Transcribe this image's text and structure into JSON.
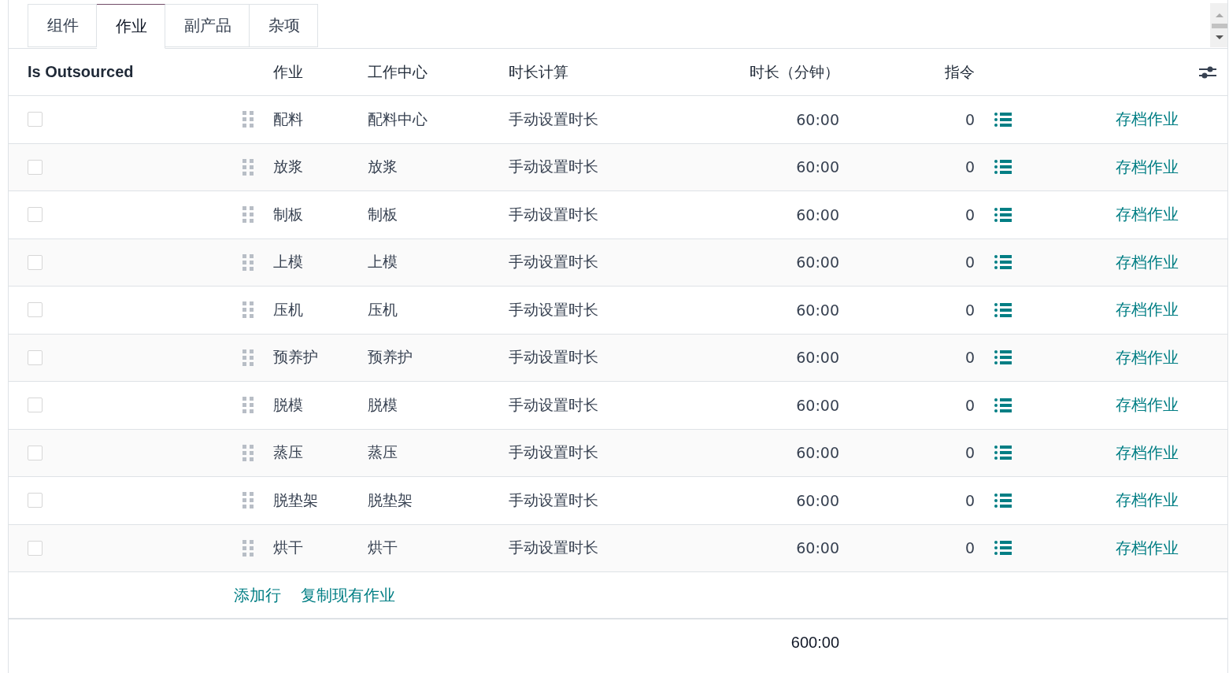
{
  "tabs": [
    {
      "label": "组件",
      "selected": false
    },
    {
      "label": "作业",
      "selected": true
    },
    {
      "label": "副产品",
      "selected": false
    },
    {
      "label": "杂项",
      "selected": false
    }
  ],
  "table": {
    "columns": [
      "Is Outsourced",
      "作业",
      "工作中心",
      "时长计算",
      "时长（分钟）",
      "指令"
    ],
    "rows": [
      {
        "is_outsourced": false,
        "operation": "配料",
        "work_center": "配料中心",
        "duration_computation": "手动设置时长",
        "duration": "60:00",
        "instructions": "0",
        "action": "存档作业"
      },
      {
        "is_outsourced": false,
        "operation": "放浆",
        "work_center": "放浆",
        "duration_computation": "手动设置时长",
        "duration": "60:00",
        "instructions": "0",
        "action": "存档作业"
      },
      {
        "is_outsourced": false,
        "operation": "制板",
        "work_center": "制板",
        "duration_computation": "手动设置时长",
        "duration": "60:00",
        "instructions": "0",
        "action": "存档作业"
      },
      {
        "is_outsourced": false,
        "operation": "上模",
        "work_center": "上模",
        "duration_computation": "手动设置时长",
        "duration": "60:00",
        "instructions": "0",
        "action": "存档作业"
      },
      {
        "is_outsourced": false,
        "operation": "压机",
        "work_center": "压机",
        "duration_computation": "手动设置时长",
        "duration": "60:00",
        "instructions": "0",
        "action": "存档作业"
      },
      {
        "is_outsourced": false,
        "operation": "预养护",
        "work_center": "预养护",
        "duration_computation": "手动设置时长",
        "duration": "60:00",
        "instructions": "0",
        "action": "存档作业"
      },
      {
        "is_outsourced": false,
        "operation": "脱模",
        "work_center": "脱模",
        "duration_computation": "手动设置时长",
        "duration": "60:00",
        "instructions": "0",
        "action": "存档作业"
      },
      {
        "is_outsourced": false,
        "operation": "蒸压",
        "work_center": "蒸压",
        "duration_computation": "手动设置时长",
        "duration": "60:00",
        "instructions": "0",
        "action": "存档作业"
      },
      {
        "is_outsourced": false,
        "operation": "脱垫架",
        "work_center": "脱垫架",
        "duration_computation": "手动设置时长",
        "duration": "60:00",
        "instructions": "0",
        "action": "存档作业"
      },
      {
        "is_outsourced": false,
        "operation": "烘干",
        "work_center": "烘干",
        "duration_computation": "手动设置时长",
        "duration": "60:00",
        "instructions": "0",
        "action": "存档作业"
      }
    ],
    "footer_links": [
      "添加行",
      "复制现有作业"
    ],
    "total_duration": "600:00"
  }
}
